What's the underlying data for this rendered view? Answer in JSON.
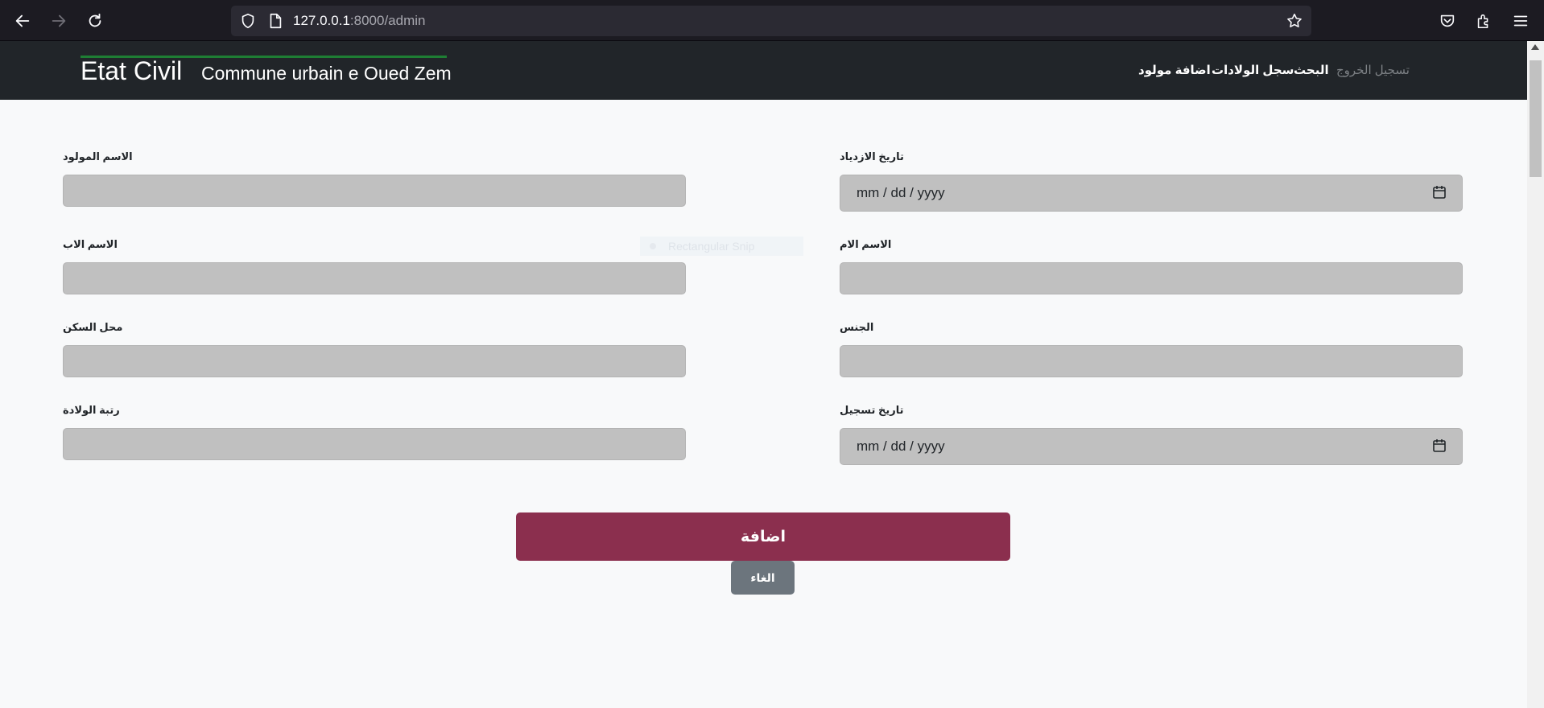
{
  "browser": {
    "url_host": "127.0.0.1",
    "url_path": ":8000/admin"
  },
  "navbar": {
    "brand": "Etat Civil",
    "subtitle": "Commune urbain e Oued Zem",
    "links": {
      "logout": "تسجيل الخروج",
      "search": "البحث",
      "births_registry": "سجل الولادات",
      "add_newborn": "اضافة مولود"
    }
  },
  "form": {
    "newborn_name_label": "الاسم المولود",
    "birth_date_label": "تاريخ الازدياد",
    "father_name_label": "الاسم الاب",
    "mother_name_label": "الاسم الام",
    "residence_label": "محل السكن",
    "gender_label": "الجنس",
    "birth_order_label": "رتبة الولادة",
    "registration_date_label": "تاريخ تسجيل",
    "date_placeholder": "mm / dd / yyyy",
    "ghost_text": "Rectangular Snip",
    "submit_label": "اضافة",
    "cancel_label": "الغاء"
  },
  "colors": {
    "navbar_bg": "#212529",
    "brand_accent": "#1e7e34",
    "submit_bg": "#8b2f4e",
    "cancel_bg": "#6c757d",
    "input_bg": "#c0c0c0"
  }
}
